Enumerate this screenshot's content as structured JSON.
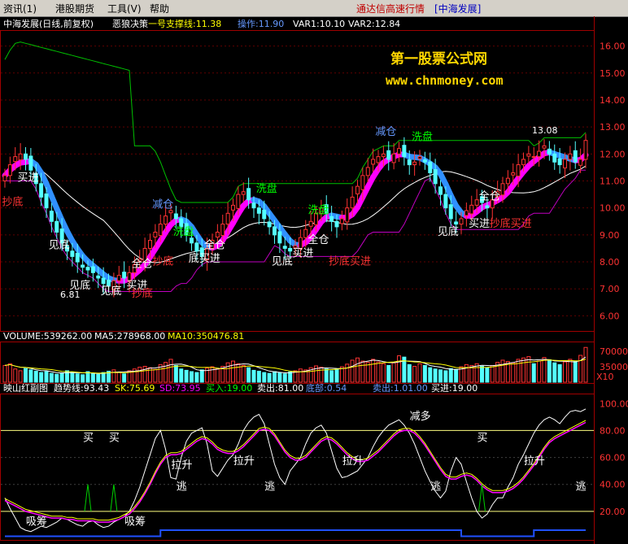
{
  "menubar": {
    "items": [
      "资讯(1)",
      "港股期货",
      "工具(V)",
      "帮助"
    ],
    "banner": "通达信高速行情",
    "banner_stock": "[中海发展]"
  },
  "colors": {
    "bg": "#000000",
    "panel_border": "#a00000",
    "candle_up": "#ff3333",
    "candle_down": "#54ffff",
    "ma_white": "#ffffff",
    "ma_yellow": "#ffff00",
    "ma_magenta": "#ff00ff",
    "support_green": "#00c000",
    "stop_magenta": "#c000c0",
    "signal_yellow": "#ffff00",
    "signal_red": "#ff3333",
    "signal_white": "#ffffff",
    "watermark": "#ffd700"
  },
  "watermark": {
    "line1": "第一股票公式网",
    "line2": "www.chnmoney.com"
  },
  "main_panel": {
    "title": "中海发展(日线,前复权)",
    "indicator": "恶狼决策",
    "support_label": "一号支撑线:11.38",
    "op_label": "操作:11.90",
    "var1_label": "VAR1:10.10",
    "var2_label": "VAR2:12.84",
    "y_ticks": [
      "16.00",
      "15.00",
      "14.00",
      "13.00",
      "12.00",
      "11.00",
      "10.00",
      "9.00",
      "8.00",
      "7.00",
      "6.00"
    ],
    "max_label": "13.08",
    "min_label": "6.81",
    "annotations": [
      {
        "text": "买进",
        "color": "#ffffff",
        "i": 4,
        "p": 11.0
      },
      {
        "text": "抄底",
        "color": "#ff3333",
        "i": 1,
        "p": 10.1
      },
      {
        "text": "见底",
        "color": "#ffffff",
        "i": 10,
        "p": 8.5
      },
      {
        "text": "见底",
        "color": "#ffffff",
        "i": 14,
        "p": 7.0
      },
      {
        "text": "见底",
        "color": "#ffffff",
        "i": 20,
        "p": 6.8
      },
      {
        "text": "买进",
        "color": "#ffffff",
        "i": 25,
        "p": 7.0
      },
      {
        "text": "抄底",
        "color": "#ff3333",
        "i": 26,
        "p": 6.7
      },
      {
        "text": "全仓",
        "color": "#ffffff",
        "i": 26,
        "p": 7.8
      },
      {
        "text": "抄底",
        "color": "#ff3333",
        "i": 30,
        "p": 7.9
      },
      {
        "text": "减仓",
        "color": "#6699ff",
        "i": 30,
        "p": 10.0
      },
      {
        "text": "洗盘",
        "color": "#00ff00",
        "i": 34,
        "p": 9.0
      },
      {
        "text": "底买进",
        "color": "#ffffff",
        "i": 37,
        "p": 8.0
      },
      {
        "text": "全仓",
        "color": "#ffffff",
        "i": 40,
        "p": 8.5
      },
      {
        "text": "洗盘",
        "color": "#00ff00",
        "i": 50,
        "p": 10.6
      },
      {
        "text": "见底",
        "color": "#ffffff",
        "i": 53,
        "p": 7.9
      },
      {
        "text": "买进",
        "color": "#ffffff",
        "i": 57,
        "p": 8.2
      },
      {
        "text": "洗盘",
        "color": "#00ff00",
        "i": 60,
        "p": 9.8
      },
      {
        "text": "全仓",
        "color": "#ffffff",
        "i": 60,
        "p": 8.7
      },
      {
        "text": "抄底买进",
        "color": "#ff3333",
        "i": 64,
        "p": 7.9
      },
      {
        "text": "减仓",
        "color": "#6699ff",
        "i": 73,
        "p": 12.7
      },
      {
        "text": "洗盘",
        "color": "#00ff00",
        "i": 80,
        "p": 12.5
      },
      {
        "text": "见底",
        "color": "#ffffff",
        "i": 85,
        "p": 9.0
      },
      {
        "text": "全仓",
        "color": "#ffffff",
        "i": 93,
        "p": 10.3
      },
      {
        "text": "买进",
        "color": "#ffffff",
        "i": 91,
        "p": 9.3
      },
      {
        "text": "抄底买进",
        "color": "#ff3333",
        "i": 95,
        "p": 9.3
      }
    ]
  },
  "volume_panel": {
    "title": "VOLUME:539262.00",
    "ma5_label": "MA5:278968.00",
    "ma10_label": "MA10:350476.81",
    "y_ticks": [
      "70000",
      "35000"
    ],
    "unit": "X10"
  },
  "osc_panel": {
    "title": "映山红副图",
    "trend_label": "趋势线:93.43",
    "sk_label": "SK:75.69",
    "sd_label": "SD:73.95",
    "buy_label": "买入:19.00",
    "sell_label": "卖出:81.00",
    "danger_label": "底部:0.54",
    "sell2_label": "卖出:1.01.00",
    "buy2_label": "买进:19.00",
    "y_ticks": [
      "100.00",
      "80.00",
      "60.00",
      "40.00",
      "20.00"
    ],
    "annotations": [
      {
        "text": "买",
        "color": "#ffffff",
        "i": 16,
        "v": 72
      },
      {
        "text": "买",
        "color": "#ffffff",
        "i": 21,
        "v": 72
      },
      {
        "text": "吸筹",
        "color": "#ffffff",
        "i": 5,
        "v": 10
      },
      {
        "text": "吸筹",
        "color": "#ffffff",
        "i": 24,
        "v": 10
      },
      {
        "text": "拉升",
        "color": "#ffffff",
        "i": 33,
        "v": 52
      },
      {
        "text": "逃",
        "color": "#ffffff",
        "i": 34,
        "v": 36
      },
      {
        "text": "拉升",
        "color": "#ffffff",
        "i": 45,
        "v": 55
      },
      {
        "text": "逃",
        "color": "#ffffff",
        "i": 51,
        "v": 36
      },
      {
        "text": "拉升",
        "color": "#ffffff",
        "i": 66,
        "v": 55
      },
      {
        "text": "减多",
        "color": "#ffffff",
        "i": 79,
        "v": 88
      },
      {
        "text": "逃",
        "color": "#ffffff",
        "i": 83,
        "v": 36
      },
      {
        "text": "买",
        "color": "#ffffff",
        "i": 92,
        "v": 72
      },
      {
        "text": "拉升",
        "color": "#ffffff",
        "i": 101,
        "v": 55
      },
      {
        "text": "逃",
        "color": "#ffffff",
        "i": 111,
        "v": 36
      }
    ]
  },
  "chart_data": {
    "type": "line",
    "title": "中海发展(日线,前复权) 恶狼决策",
    "ylim_price": [
      5.5,
      16.5
    ],
    "ylim_volume": [
      0,
      85000
    ],
    "ylim_osc": [
      0,
      105
    ],
    "close": [
      11.2,
      11.6,
      11.9,
      12.0,
      11.8,
      11.4,
      10.9,
      10.4,
      10.0,
      9.5,
      9.1,
      8.7,
      8.4,
      8.2,
      8.0,
      7.8,
      7.7,
      7.6,
      7.4,
      7.2,
      7.1,
      7.3,
      7.5,
      7.4,
      7.6,
      7.9,
      8.1,
      8.5,
      8.8,
      9.1,
      9.4,
      9.7,
      9.9,
      9.6,
      9.3,
      9.0,
      8.7,
      8.4,
      8.2,
      8.5,
      8.8,
      9.1,
      9.4,
      9.8,
      10.1,
      10.5,
      10.6,
      10.3,
      10.0,
      9.8,
      9.6,
      9.3,
      9.0,
      8.7,
      8.5,
      8.4,
      8.6,
      8.9,
      9.2,
      9.5,
      9.8,
      10.0,
      9.8,
      9.5,
      9.3,
      9.6,
      10.0,
      10.4,
      10.8,
      11.2,
      11.5,
      11.8,
      11.9,
      12.0,
      11.8,
      12.0,
      12.2,
      11.9,
      11.6,
      11.7,
      11.9,
      11.7,
      11.3,
      10.9,
      10.5,
      10.0,
      9.6,
      9.4,
      9.6,
      9.9,
      10.1,
      10.3,
      10.2,
      10.0,
      10.3,
      10.6,
      10.9,
      11.1,
      11.3,
      11.6,
      11.8,
      12.0,
      11.9,
      12.1,
      12.3,
      12.0,
      11.7,
      11.6,
      11.8,
      12.0,
      11.7,
      11.8,
      12.5
    ],
    "volume": [
      38000,
      42000,
      30000,
      26000,
      31000,
      28000,
      25000,
      22000,
      24000,
      20000,
      18000,
      21000,
      26000,
      23000,
      19000,
      17000,
      24000,
      20000,
      18000,
      22000,
      25000,
      28000,
      23000,
      19000,
      26000,
      30000,
      34000,
      36000,
      33000,
      29000,
      40000,
      45000,
      52000,
      38000,
      30000,
      27000,
      24000,
      22000,
      28000,
      32000,
      35000,
      31000,
      36000,
      44000,
      48000,
      42000,
      38000,
      33000,
      27000,
      25000,
      22000,
      20000,
      24000,
      21000,
      19000,
      23000,
      26000,
      30000,
      28000,
      33000,
      37000,
      34000,
      30000,
      26000,
      29000,
      35000,
      41000,
      50000,
      55000,
      48000,
      45000,
      52000,
      46000,
      42000,
      38000,
      44000,
      60000,
      57000,
      40000,
      36000,
      42000,
      38000,
      33000,
      30000,
      28000,
      26000,
      31000,
      29000,
      35000,
      40000,
      38000,
      42000,
      36000,
      33000,
      38000,
      45000,
      50000,
      47000,
      44000,
      52000,
      55000,
      58000,
      42000,
      48000,
      56000,
      51000,
      44000,
      40000,
      46000,
      52000,
      48000,
      61000,
      79000
    ],
    "osc_white": [
      30,
      22,
      15,
      8,
      6,
      5,
      7,
      9,
      8,
      10,
      12,
      15,
      14,
      12,
      10,
      9,
      12,
      13,
      10,
      8,
      9,
      12,
      14,
      16,
      20,
      28,
      38,
      50,
      62,
      74,
      80,
      66,
      45,
      44,
      60,
      72,
      78,
      80,
      82,
      70,
      50,
      46,
      52,
      58,
      62,
      70,
      80,
      86,
      90,
      92,
      85,
      70,
      55,
      45,
      40,
      50,
      55,
      60,
      70,
      78,
      82,
      84,
      78,
      65,
      52,
      45,
      46,
      48,
      50,
      55,
      60,
      68,
      75,
      80,
      84,
      86,
      88,
      84,
      78,
      70,
      60,
      50,
      42,
      35,
      30,
      35,
      50,
      60,
      55,
      42,
      30,
      20,
      15,
      18,
      25,
      30,
      30,
      38,
      45,
      55,
      62,
      70,
      78,
      84,
      88,
      90,
      88,
      85,
      90,
      94,
      95,
      94,
      96
    ],
    "osc_red": [
      28,
      26,
      24,
      22,
      20,
      19,
      18,
      17,
      16,
      15,
      15,
      15,
      14,
      14,
      13,
      13,
      13,
      13,
      12,
      12,
      12,
      13,
      14,
      16,
      18,
      22,
      27,
      33,
      40,
      48,
      55,
      60,
      62,
      62,
      63,
      66,
      69,
      72,
      74,
      73,
      70,
      66,
      64,
      63,
      63,
      65,
      68,
      72,
      76,
      80,
      81,
      80,
      76,
      70,
      64,
      60,
      58,
      58,
      60,
      64,
      68,
      72,
      74,
      73,
      70,
      66,
      62,
      59,
      57,
      57,
      58,
      61,
      64,
      68,
      72,
      76,
      79,
      80,
      80,
      78,
      74,
      69,
      63,
      57,
      51,
      46,
      44,
      44,
      46,
      47,
      46,
      43,
      39,
      36,
      34,
      34,
      34,
      35,
      37,
      40,
      44,
      49,
      54,
      60,
      66,
      71,
      74,
      76,
      78,
      80,
      82,
      84,
      86
    ],
    "osc_green_spikes": [
      {
        "i": 16,
        "v": 40
      },
      {
        "i": 21,
        "v": 40
      },
      {
        "i": 92,
        "v": 40
      }
    ],
    "osc_blue_step": [
      0,
      0,
      0,
      0,
      0,
      0,
      0,
      0,
      0,
      0,
      0,
      0,
      0,
      0,
      0,
      0,
      0,
      0,
      0,
      0,
      0,
      0,
      0,
      0,
      0,
      0,
      0,
      0,
      0,
      0,
      1,
      1,
      1,
      1,
      1,
      1,
      1,
      1,
      1,
      1,
      1,
      1,
      1,
      1,
      1,
      1,
      1,
      1,
      1,
      1,
      1,
      1,
      1,
      1,
      1,
      1,
      1,
      1,
      1,
      1,
      1,
      1,
      1,
      1,
      1,
      1,
      1,
      1,
      1,
      1,
      1,
      1,
      1,
      1,
      1,
      1,
      1,
      1,
      1,
      1,
      1,
      1,
      1,
      1,
      1,
      1,
      1,
      1,
      0,
      0,
      0,
      0,
      0,
      0,
      0,
      0,
      0,
      0,
      0,
      0,
      0,
      0,
      1,
      1,
      1,
      1,
      1,
      1,
      1,
      1,
      1,
      1,
      1
    ]
  }
}
